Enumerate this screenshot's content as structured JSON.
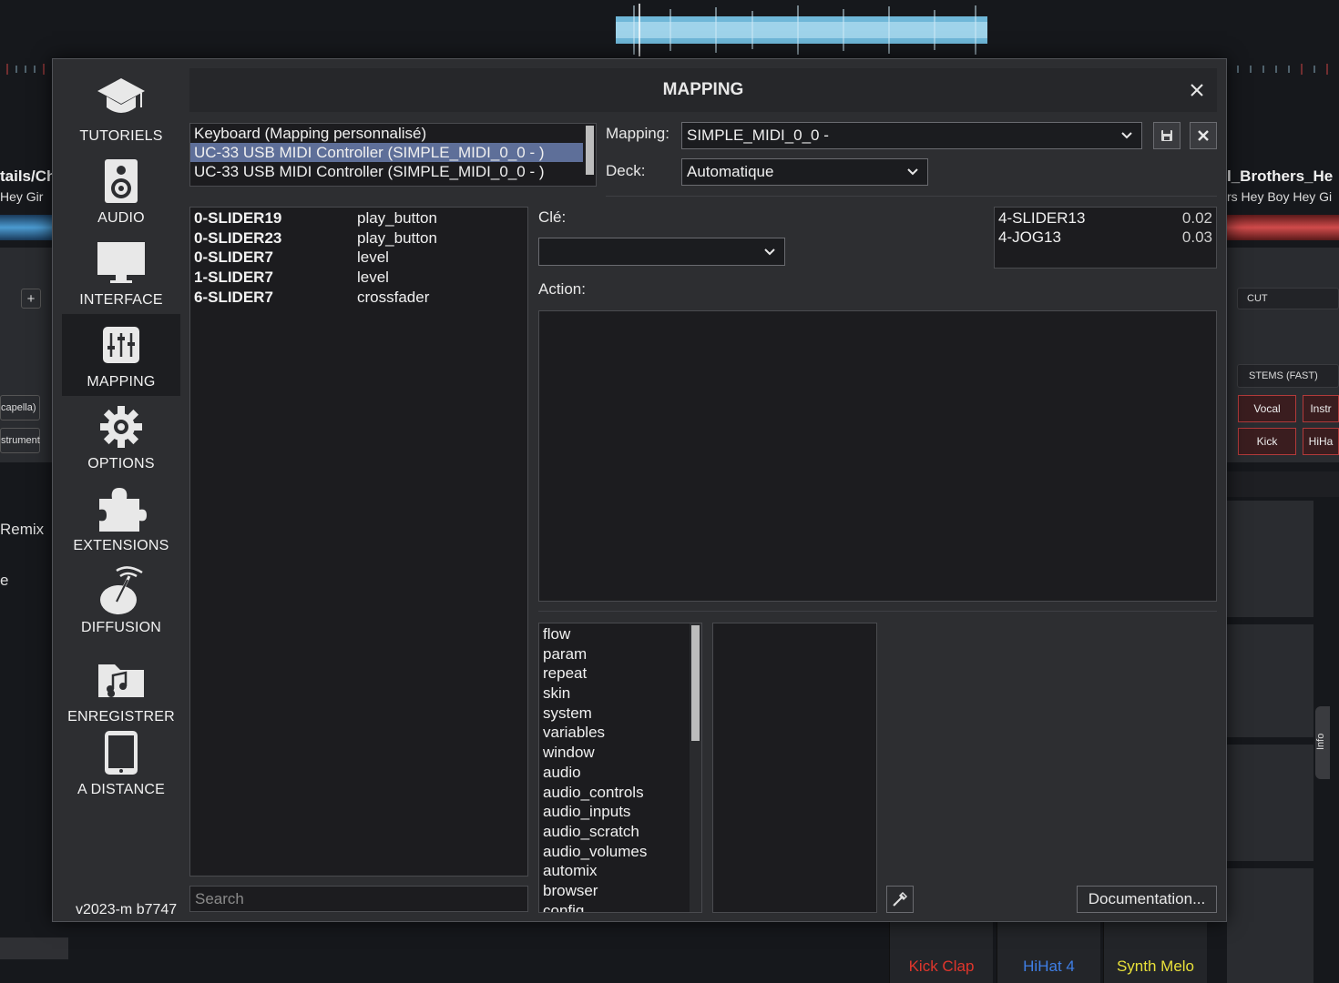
{
  "background": {
    "left_deck": {
      "title": "tails/Ch",
      "subtitle": "Hey Gir",
      "track1": "Remix",
      "track2": "e",
      "stem1": "capella)",
      "stem2": "strument",
      "add_label": "+"
    },
    "right_deck": {
      "title": "l_Brothers_He",
      "subtitle": "rs Hey Boy Hey Gi",
      "cut_label": "CUT",
      "stems_label": "STEMS (FAST)",
      "stem_vocal": "Vocal",
      "stem_instr": "Instr",
      "stem_kick": "Kick",
      "stem_hihat": "HiHa",
      "info_tab": "Info"
    },
    "pads": [
      {
        "label": "Kick Clap",
        "color": "#e0362c"
      },
      {
        "label": "HiHat 4",
        "color": "#3f7fe6"
      },
      {
        "label": "Synth Melo",
        "color": "#e8e03a"
      }
    ]
  },
  "sidebar": {
    "items": [
      {
        "label": "TUTORIELS",
        "icon": "graduation-cap-icon"
      },
      {
        "label": "AUDIO",
        "icon": "speaker-icon"
      },
      {
        "label": "INTERFACE",
        "icon": "monitor-icon"
      },
      {
        "label": "MAPPING",
        "icon": "sliders-icon",
        "active": true
      },
      {
        "label": "OPTIONS",
        "icon": "gear-icon"
      },
      {
        "label": "EXTENSIONS",
        "icon": "puzzle-icon"
      },
      {
        "label": "DIFFUSION",
        "icon": "broadcast-dish-icon"
      },
      {
        "label": "ENREGISTRER",
        "icon": "music-folder-icon"
      },
      {
        "label": "A DISTANCE",
        "icon": "tablet-icon"
      }
    ],
    "version": "v2023-m b7747"
  },
  "dialog": {
    "title": "MAPPING",
    "devices": [
      "Keyboard (Mapping personnalisé)",
      "UC-33 USB MIDI Controller (SIMPLE_MIDI_0_0 - )",
      "UC-33 USB MIDI Controller (SIMPLE_MIDI_0_0 - )"
    ],
    "selected_device_index": 1,
    "mapping_label": "Mapping:",
    "mapping_value": "SIMPLE_MIDI_0_0 -",
    "deck_label": "Deck:",
    "deck_value": "Automatique",
    "key_label": "Clé:",
    "key_value": "",
    "action_label": "Action:",
    "mappings": [
      {
        "key": "0-SLIDER19",
        "action": "play_button"
      },
      {
        "key": "0-SLIDER23",
        "action": "play_button"
      },
      {
        "key": "0-SLIDER7",
        "action": "level"
      },
      {
        "key": "1-SLIDER7",
        "action": "level"
      },
      {
        "key": "6-SLIDER7",
        "action": "crossfader"
      }
    ],
    "monitor": [
      {
        "key": "4-SLIDER13",
        "value": "0.02"
      },
      {
        "key": "4-JOG13",
        "value": "0.03"
      }
    ],
    "verbs": [
      "flow",
      "param",
      "repeat",
      "skin",
      "system",
      "variables",
      "window",
      "audio",
      "audio_controls",
      "audio_inputs",
      "audio_scratch",
      "audio_volumes",
      "automix",
      "browser",
      "config"
    ],
    "search_placeholder": "Search",
    "documentation_label": "Documentation..."
  }
}
